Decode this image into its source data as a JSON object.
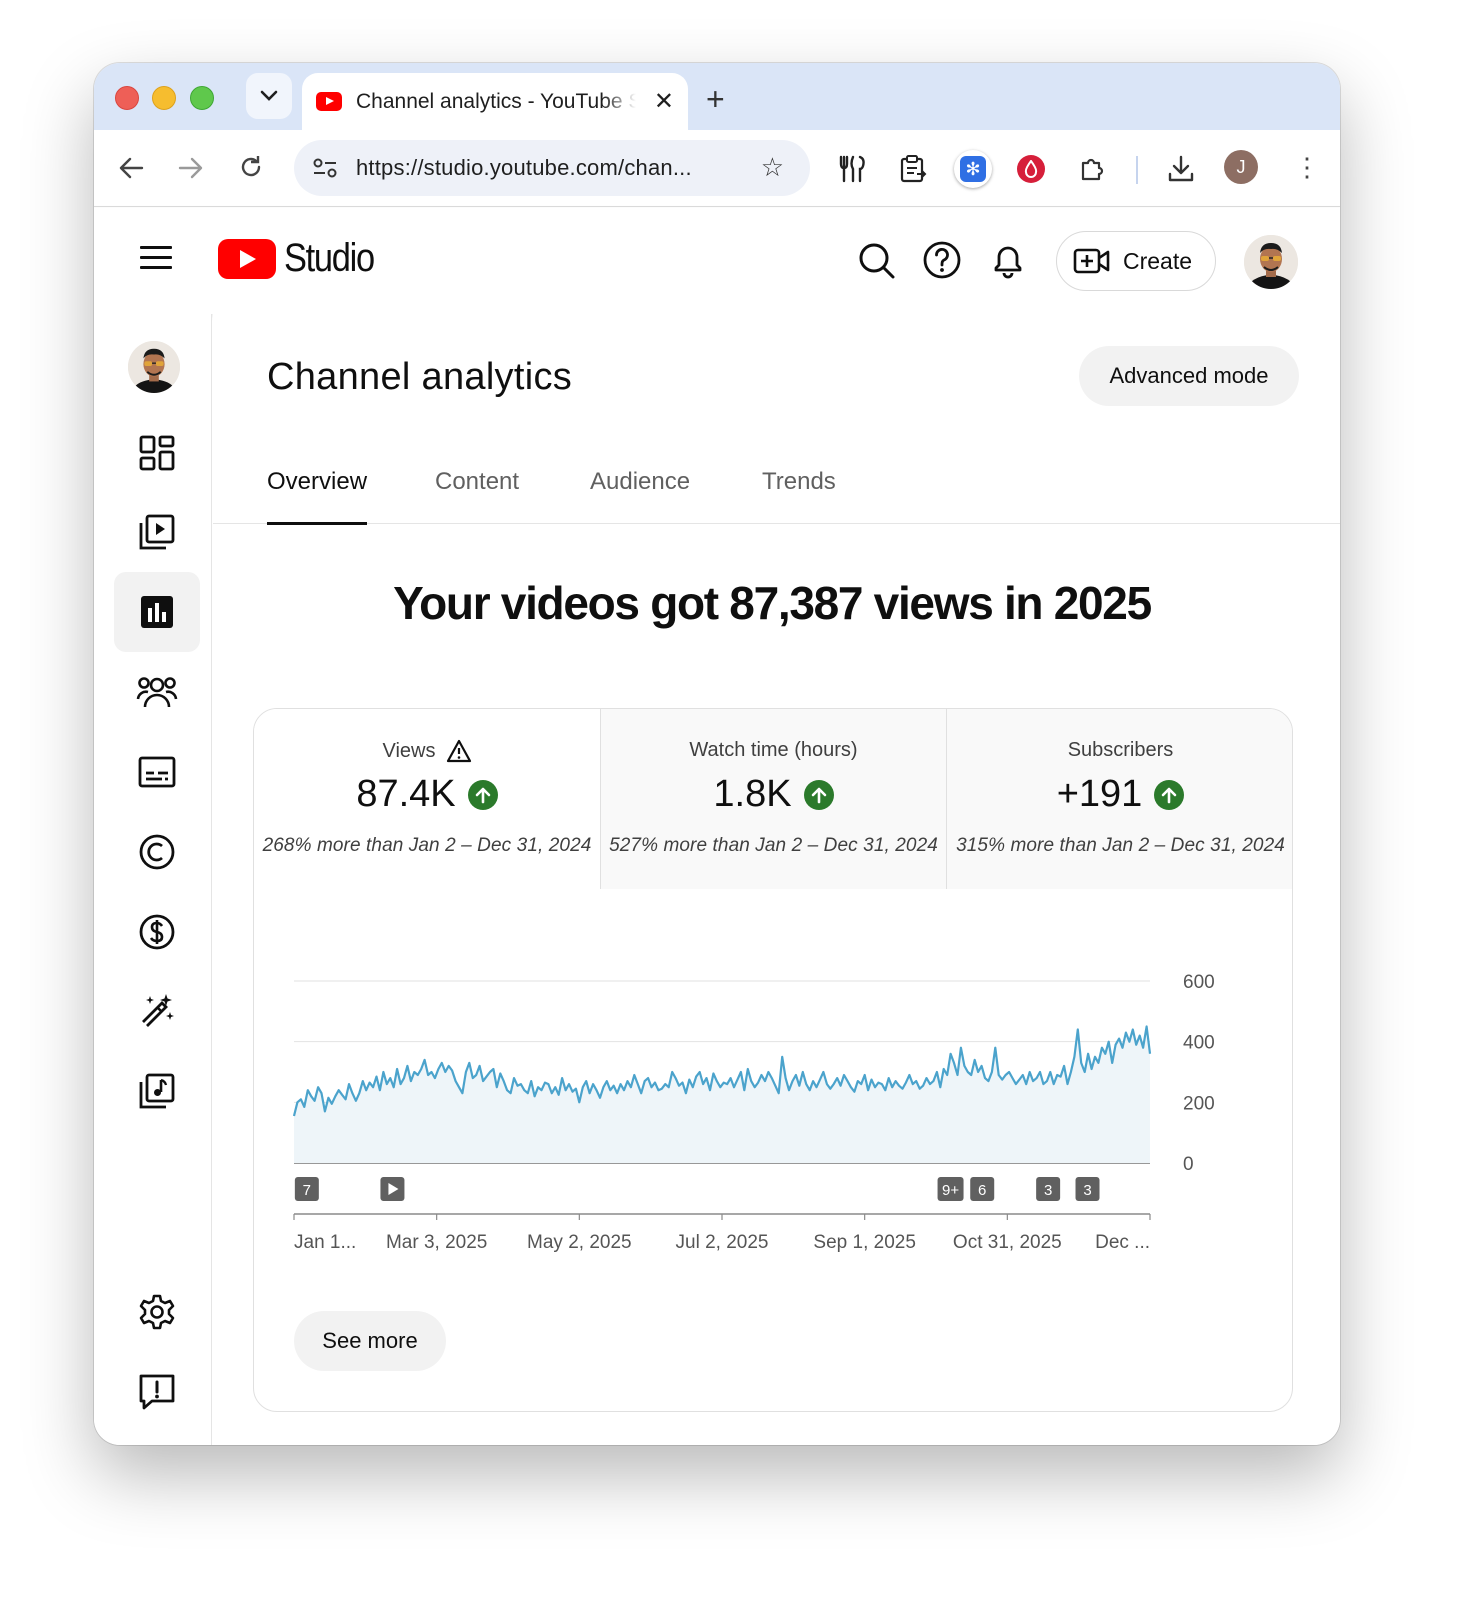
{
  "browser": {
    "tab_title": "Channel analytics - YouTube Studio",
    "url": "https://studio.youtube.com/chan...",
    "profile_initial": "J"
  },
  "studio": {
    "logo_text": "Studio",
    "create_label": "Create"
  },
  "page": {
    "title": "Channel analytics",
    "advanced_mode": "Advanced mode",
    "tabs": [
      {
        "label": "Overview",
        "active": true
      },
      {
        "label": "Content",
        "active": false
      },
      {
        "label": "Audience",
        "active": false
      },
      {
        "label": "Trends",
        "active": false
      }
    ],
    "headline": "Your videos got 87,387 views in 2025",
    "see_more": "See more"
  },
  "metrics": [
    {
      "label": "Views",
      "warning": true,
      "value": "87.4K",
      "trend": "up",
      "comparison": "268% more than Jan 2 – Dec 31, 2024"
    },
    {
      "label": "Watch time (hours)",
      "warning": false,
      "value": "1.8K",
      "trend": "up",
      "comparison": "527% more than Jan 2 – Dec 31, 2024"
    },
    {
      "label": "Subscribers",
      "warning": false,
      "value": "+191",
      "trend": "up",
      "comparison": "315% more than Jan 2 – Dec 31, 2024"
    }
  ],
  "sidebar_icons": [
    "dashboard-icon",
    "content-icon",
    "analytics-icon",
    "community-icon",
    "subtitles-icon",
    "copyright-icon",
    "earn-icon",
    "customization-icon",
    "audio-library-icon",
    "settings-icon",
    "feedback-icon"
  ],
  "colors": {
    "line": "#4ba3cc",
    "fill": "#eef5f9",
    "brand_red": "#ff0000",
    "up_green": "#2b7a2b"
  },
  "chart_data": {
    "type": "line",
    "series_name": "",
    "y_ticks": [
      "600",
      "400",
      "200",
      "0"
    ],
    "ylim": [
      0,
      600
    ],
    "x_tick_labels": [
      "Jan 1...",
      "Mar 3, 2025",
      "May 2, 2025",
      "Jul 2, 2025",
      "Sep 1, 2025",
      "Oct 31, 2025",
      "Dec ..."
    ],
    "markers": [
      {
        "label": "7",
        "at": 0.015
      },
      {
        "label": "▶",
        "at": 0.115
      },
      {
        "label": "9+",
        "at": 0.767
      },
      {
        "label": "6",
        "at": 0.804
      },
      {
        "label": "3",
        "at": 0.881
      },
      {
        "label": "3",
        "at": 0.927
      }
    ],
    "values": [
      155,
      200,
      210,
      185,
      240,
      220,
      205,
      250,
      230,
      170,
      215,
      195,
      220,
      240,
      225,
      210,
      260,
      230,
      205,
      230,
      270,
      240,
      265,
      250,
      285,
      240,
      300,
      260,
      280,
      250,
      310,
      260,
      280,
      320,
      270,
      300,
      290,
      310,
      340,
      290,
      300,
      280,
      310,
      330,
      300,
      320,
      305,
      270,
      250,
      230,
      300,
      330,
      280,
      290,
      320,
      270,
      285,
      300,
      310,
      250,
      295,
      270,
      240,
      230,
      280,
      255,
      260,
      240,
      230,
      270,
      220,
      250,
      240,
      265,
      260,
      230,
      250,
      225,
      280,
      240,
      260,
      235,
      245,
      200,
      250,
      270,
      230,
      260,
      240,
      215,
      250,
      270,
      240,
      255,
      230,
      260,
      240,
      270,
      250,
      290,
      260,
      230,
      270,
      280,
      250,
      265,
      240,
      245,
      260,
      250,
      300,
      280,
      255,
      265,
      230,
      275,
      250,
      285,
      300,
      260,
      280,
      240,
      295,
      270,
      250,
      265,
      260,
      280,
      250,
      275,
      300,
      240,
      310,
      270,
      250,
      265,
      290,
      270,
      300,
      280,
      255,
      230,
      350,
      280,
      240,
      270,
      290,
      255,
      300,
      260,
      240,
      270,
      250,
      275,
      300,
      260,
      245,
      260,
      280,
      255,
      290,
      270,
      250,
      235,
      270,
      260,
      290,
      240,
      275,
      250,
      265,
      260,
      240,
      280,
      250,
      270,
      255,
      245,
      265,
      290,
      260,
      270,
      245,
      255,
      280,
      260,
      270,
      300,
      250,
      310,
      290,
      360,
      330,
      290,
      380,
      320,
      300,
      290,
      340,
      300,
      320,
      280,
      270,
      300,
      380,
      290,
      275,
      290,
      300,
      280,
      260,
      275,
      290,
      260,
      300,
      270,
      280,
      300,
      260,
      270,
      300,
      260,
      290,
      285,
      320,
      260,
      300,
      350,
      440,
      330,
      300,
      360,
      310,
      350,
      330,
      380,
      360,
      400,
      330,
      390,
      410,
      380,
      430,
      400,
      440,
      390,
      420,
      380,
      450,
      360
    ]
  }
}
